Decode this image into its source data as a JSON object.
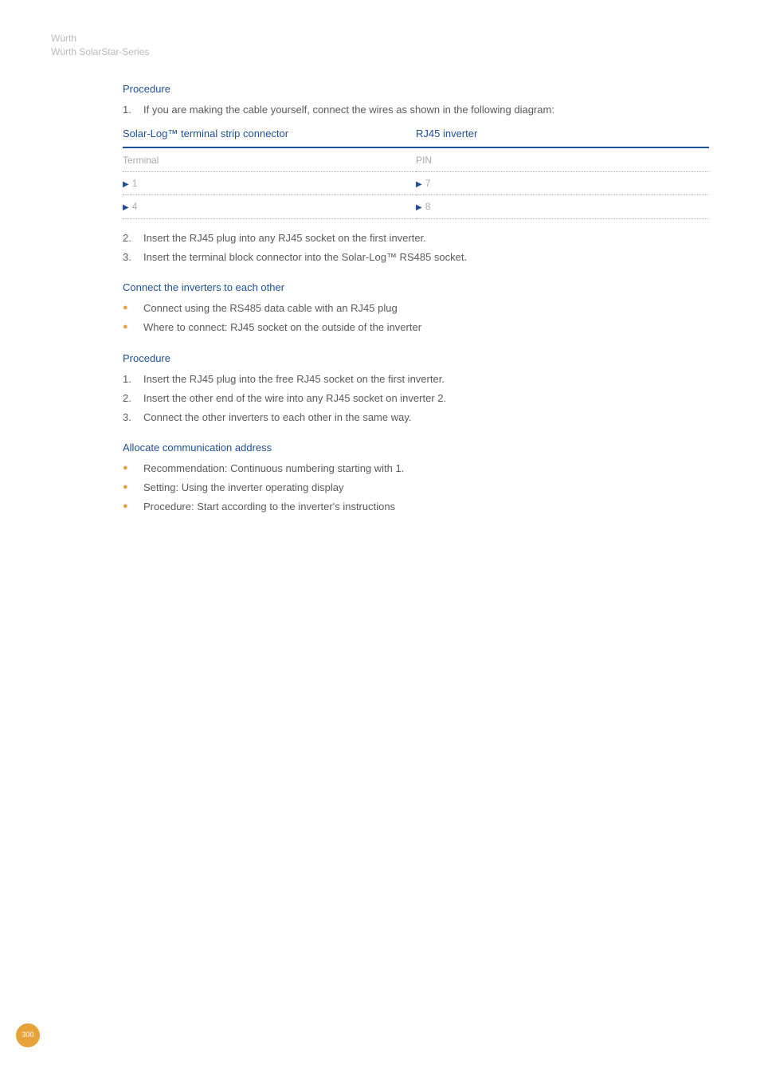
{
  "page_header": {
    "line1": "Würth",
    "line2": "Würth SolarStar-Series"
  },
  "section1": {
    "heading": "Procedure",
    "items": {
      "0": {
        "num": "1.",
        "text": "If you are making the cable yourself, connect the wires as shown in the following diagram:"
      }
    }
  },
  "table": {
    "head_left": "Solar-Log™ terminal strip connector",
    "head_right": "RJ45 inverter",
    "sub_left": "Terminal",
    "sub_right": "PIN",
    "rows": {
      "0": {
        "left": "1",
        "right": "7"
      },
      "1": {
        "left": "4",
        "right": "8"
      }
    }
  },
  "section1b": {
    "items": {
      "0": {
        "num": "2.",
        "text": "Insert the RJ45 plug into any RJ45 socket on the first inverter."
      },
      "1": {
        "num": "3.",
        "text": "Insert the terminal block connector into the Solar-Log™ RS485 socket."
      }
    }
  },
  "section2": {
    "heading": "Connect the inverters to each other",
    "bullets": {
      "0": "Connect using the RS485 data cable with an RJ45 plug",
      "1": "Where to connect: RJ45 socket on the outside of the inverter"
    }
  },
  "section3": {
    "heading": "Procedure",
    "items": {
      "0": {
        "num": "1.",
        "text": "Insert the RJ45 plug into the free RJ45 socket on the first inverter."
      },
      "1": {
        "num": "2.",
        "text": "Insert the other end of the wire into any RJ45 socket on inverter 2."
      },
      "2": {
        "num": "3.",
        "text": "Connect the other inverters to each other in the same way."
      }
    }
  },
  "section4": {
    "heading": "Allocate communication address",
    "bullets": {
      "0": "Recommendation: Continuous numbering starting with 1.",
      "1": "Setting: Using the inverter operating display",
      "2": "Procedure: Start according to the inverter's instructions"
    }
  },
  "page_number": "300"
}
